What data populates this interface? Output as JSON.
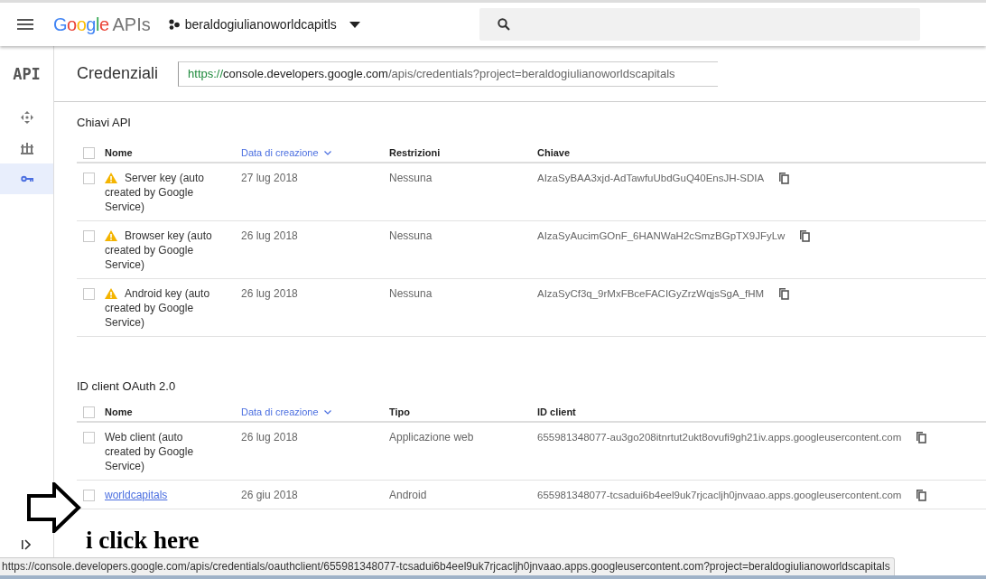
{
  "header": {
    "logo": "Google",
    "product": "APIs",
    "project": "beraldogiulianoworldcapitls"
  },
  "sidebar": {
    "logo": "API",
    "items": [
      {
        "kind": "move",
        "selected": false
      },
      {
        "kind": "dashboard",
        "selected": false
      },
      {
        "kind": "key",
        "selected": true
      }
    ]
  },
  "page": {
    "title": "Credenziali",
    "url": [
      "https://",
      "console.developers.google.com",
      "/apis/credentials?project=beraldogiulianoworldscapitals"
    ]
  },
  "sections": [
    {
      "title": "Chiavi API",
      "all_checked": false,
      "columns": [
        {
          "label": "Nome",
          "sorted": false
        },
        {
          "label": "Data di creazione",
          "sorted": true
        },
        {
          "label": "Restrizioni",
          "sorted": false
        },
        {
          "label": "Chiave",
          "sorted": false
        }
      ],
      "rows": [
        {
          "checked": false,
          "warning": true,
          "link": false,
          "name": "Server key (auto created by Google Service)",
          "date": "27 lug 2018",
          "info": "Nessuna",
          "value": "AIzaSyBAA3xjd-AdTawfuUbdGuQ40EnsJH-SDIA"
        },
        {
          "checked": false,
          "warning": true,
          "link": false,
          "name": "Browser key (auto created by Google Service)",
          "date": "26 lug 2018",
          "info": "Nessuna",
          "value": "AIzaSyAucimGOnF_6HANWaH2cSmzBGpTX9JFyLw"
        },
        {
          "checked": false,
          "warning": true,
          "link": false,
          "name": "Android key (auto created by Google Service)",
          "date": "26 lug 2018",
          "info": "Nessuna",
          "value": "AIzaSyCf3q_9rMxFBceFACIGyZrzWqjsSgA_fHM"
        }
      ]
    },
    {
      "title": "ID client OAuth 2.0",
      "all_checked": false,
      "columns": [
        {
          "label": "Nome",
          "sorted": false
        },
        {
          "label": "Data di creazione",
          "sorted": true
        },
        {
          "label": "Tipo",
          "sorted": false
        },
        {
          "label": "ID client",
          "sorted": false
        }
      ],
      "rows": [
        {
          "checked": false,
          "warning": false,
          "link": false,
          "name": "Web client (auto created by Google Service)",
          "date": "26 lug 2018",
          "info": "Applicazione web",
          "value": "655981348077-au3go208itnrtut2ukt8ovufi9gh21iv.apps.googleusercontent.com"
        },
        {
          "checked": false,
          "warning": false,
          "link": true,
          "name": "worldcapitals",
          "date": "26 giu 2018",
          "info": "Android",
          "value": "655981348077-tcsadui6b4eel9uk7rjcacljh0jnvaao.apps.googleusercontent.com"
        }
      ]
    }
  ],
  "annotation": {
    "text": "i click here"
  },
  "status_bar": {
    "url": "https://console.developers.google.com/apis/credentials/oauthclient/655981348077-tcsadui6b4eel9uk7rjcacljh0jnvaao.apps.googleusercontent.com?project=beraldogiulianoworldscapitals"
  }
}
